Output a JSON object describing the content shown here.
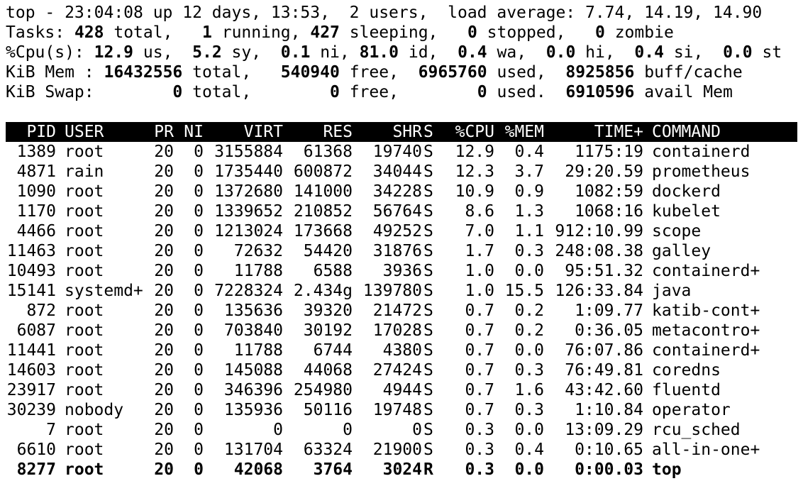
{
  "summary": {
    "line1": "top - 23:04:08 up 12 days, 13:53,  2 users,  load average: 7.74, 14.19, 14.90",
    "tasks": {
      "label": "Tasks:",
      "total": "428",
      "total_label": "total,",
      "running": "1",
      "running_label": "running,",
      "sleeping": "427",
      "sleeping_label": "sleeping,",
      "stopped": "0",
      "stopped_label": "stopped,",
      "zombie": "0",
      "zombie_label": "zombie"
    },
    "cpu": {
      "label": "%Cpu(s):",
      "us": "12.9",
      "us_label": "us,",
      "sy": "5.2",
      "sy_label": "sy,",
      "ni": "0.1",
      "ni_label": "ni,",
      "id": "81.0",
      "id_label": "id,",
      "wa": "0.4",
      "wa_label": "wa,",
      "hi": "0.0",
      "hi_label": "hi,",
      "si": "0.4",
      "si_label": "si,",
      "st": "0.0",
      "st_label": "st"
    },
    "mem": {
      "label": "KiB Mem :",
      "total": "16432556",
      "total_label": "total,",
      "free": "540940",
      "free_label": "free,",
      "used": "6965760",
      "used_label": "used,",
      "buff": "8925856",
      "buff_label": "buff/cache"
    },
    "swap": {
      "label": "KiB Swap:",
      "total": "0",
      "total_label": "total,",
      "free": "0",
      "free_label": "free,",
      "used": "0",
      "used_label": "used.",
      "avail": "6910596",
      "avail_label": "avail Mem"
    }
  },
  "columns": [
    "PID",
    "USER",
    "PR",
    "NI",
    "VIRT",
    "RES",
    "SHR",
    "S",
    "%CPU",
    "%MEM",
    "TIME+",
    "COMMAND"
  ],
  "processes": [
    {
      "pid": "1389",
      "user": "root",
      "pr": "20",
      "ni": "0",
      "virt": "3155884",
      "res": "61368",
      "shr": "19740",
      "s": "S",
      "cpu": "12.9",
      "mem": "0.4",
      "time": "1175:19",
      "cmd": "containerd"
    },
    {
      "pid": "4871",
      "user": "rain",
      "pr": "20",
      "ni": "0",
      "virt": "1735440",
      "res": "600872",
      "shr": "34044",
      "s": "S",
      "cpu": "12.3",
      "mem": "3.7",
      "time": "29:20.59",
      "cmd": "prometheus"
    },
    {
      "pid": "1090",
      "user": "root",
      "pr": "20",
      "ni": "0",
      "virt": "1372680",
      "res": "141000",
      "shr": "34228",
      "s": "S",
      "cpu": "10.9",
      "mem": "0.9",
      "time": "1082:59",
      "cmd": "dockerd"
    },
    {
      "pid": "1170",
      "user": "root",
      "pr": "20",
      "ni": "0",
      "virt": "1339652",
      "res": "210852",
      "shr": "56764",
      "s": "S",
      "cpu": "8.6",
      "mem": "1.3",
      "time": "1068:16",
      "cmd": "kubelet"
    },
    {
      "pid": "4466",
      "user": "root",
      "pr": "20",
      "ni": "0",
      "virt": "1213024",
      "res": "173668",
      "shr": "49252",
      "s": "S",
      "cpu": "7.0",
      "mem": "1.1",
      "time": "912:10.99",
      "cmd": "scope"
    },
    {
      "pid": "11463",
      "user": "root",
      "pr": "20",
      "ni": "0",
      "virt": "72632",
      "res": "54420",
      "shr": "31876",
      "s": "S",
      "cpu": "1.7",
      "mem": "0.3",
      "time": "248:08.38",
      "cmd": "galley"
    },
    {
      "pid": "10493",
      "user": "root",
      "pr": "20",
      "ni": "0",
      "virt": "11788",
      "res": "6588",
      "shr": "3936",
      "s": "S",
      "cpu": "1.0",
      "mem": "0.0",
      "time": "95:51.32",
      "cmd": "containerd+"
    },
    {
      "pid": "15141",
      "user": "systemd+",
      "pr": "20",
      "ni": "0",
      "virt": "7228324",
      "res": "2.434g",
      "shr": "139780",
      "s": "S",
      "cpu": "1.0",
      "mem": "15.5",
      "time": "126:33.84",
      "cmd": "java"
    },
    {
      "pid": "872",
      "user": "root",
      "pr": "20",
      "ni": "0",
      "virt": "135636",
      "res": "39320",
      "shr": "21472",
      "s": "S",
      "cpu": "0.7",
      "mem": "0.2",
      "time": "1:09.77",
      "cmd": "katib-cont+"
    },
    {
      "pid": "6087",
      "user": "root",
      "pr": "20",
      "ni": "0",
      "virt": "703840",
      "res": "30192",
      "shr": "17028",
      "s": "S",
      "cpu": "0.7",
      "mem": "0.2",
      "time": "0:36.05",
      "cmd": "metacontro+"
    },
    {
      "pid": "11441",
      "user": "root",
      "pr": "20",
      "ni": "0",
      "virt": "11788",
      "res": "6744",
      "shr": "4380",
      "s": "S",
      "cpu": "0.7",
      "mem": "0.0",
      "time": "76:07.86",
      "cmd": "containerd+"
    },
    {
      "pid": "14603",
      "user": "root",
      "pr": "20",
      "ni": "0",
      "virt": "145088",
      "res": "44068",
      "shr": "27424",
      "s": "S",
      "cpu": "0.7",
      "mem": "0.3",
      "time": "76:49.81",
      "cmd": "coredns"
    },
    {
      "pid": "23917",
      "user": "root",
      "pr": "20",
      "ni": "0",
      "virt": "346396",
      "res": "254980",
      "shr": "4944",
      "s": "S",
      "cpu": "0.7",
      "mem": "1.6",
      "time": "43:42.60",
      "cmd": "fluentd"
    },
    {
      "pid": "30239",
      "user": "nobody",
      "pr": "20",
      "ni": "0",
      "virt": "135936",
      "res": "50116",
      "shr": "19748",
      "s": "S",
      "cpu": "0.7",
      "mem": "0.3",
      "time": "1:10.84",
      "cmd": "operator"
    },
    {
      "pid": "7",
      "user": "root",
      "pr": "20",
      "ni": "0",
      "virt": "0",
      "res": "0",
      "shr": "0",
      "s": "S",
      "cpu": "0.3",
      "mem": "0.0",
      "time": "13:09.29",
      "cmd": "rcu_sched"
    },
    {
      "pid": "6610",
      "user": "root",
      "pr": "20",
      "ni": "0",
      "virt": "131704",
      "res": "63324",
      "shr": "21900",
      "s": "S",
      "cpu": "0.3",
      "mem": "0.4",
      "time": "0:10.65",
      "cmd": "all-in-one+"
    },
    {
      "pid": "8277",
      "user": "root",
      "pr": "20",
      "ni": "0",
      "virt": "42068",
      "res": "3764",
      "shr": "3024",
      "s": "R",
      "cpu": "0.3",
      "mem": "0.0",
      "time": "0:00.03",
      "cmd": "top"
    }
  ]
}
